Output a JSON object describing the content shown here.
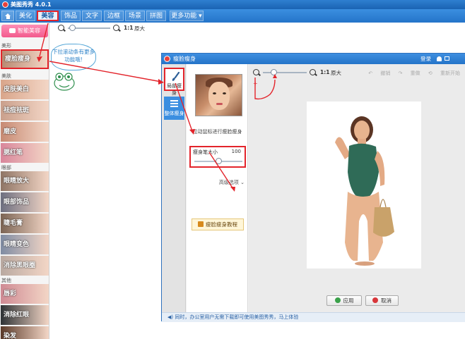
{
  "app": {
    "title": "美图秀秀 4.0.1"
  },
  "menu": {
    "home_icon": "home-icon",
    "tabs": [
      {
        "label": "美化"
      },
      {
        "label": "美容"
      },
      {
        "label": "饰品"
      },
      {
        "label": "文字"
      },
      {
        "label": "边框"
      },
      {
        "label": "场景"
      },
      {
        "label": "拼图"
      },
      {
        "label": "更多功能 ▾"
      }
    ],
    "active_index": 1
  },
  "main_zoom": {
    "ratio": "1:1",
    "size_label": "原大"
  },
  "sidebar": {
    "one_click": "智能美容",
    "sections": [
      {
        "label": "美形"
      },
      {
        "label": "美肤"
      },
      {
        "label": "眼部"
      },
      {
        "label": "其他"
      }
    ],
    "items": [
      {
        "label": "瘦脸瘦身",
        "color": "#b98a72"
      },
      {
        "label": "皮肤美白",
        "color": "#d9a58a"
      },
      {
        "label": "祛痘祛斑",
        "color": "#caa08c"
      },
      {
        "label": "磨皮",
        "color": "#c78a73"
      },
      {
        "label": "腮红笔",
        "color": "#d9869b"
      },
      {
        "label": "眼睛放大",
        "color": "#8f7565"
      },
      {
        "label": "眼部饰品",
        "color": "#6d6f80"
      },
      {
        "label": "睫毛膏",
        "color": "#7b6454"
      },
      {
        "label": "眼睛变色",
        "color": "#7f8ca3"
      },
      {
        "label": "消除黑眼圈",
        "color": "#b9a9a1"
      },
      {
        "label": "唇彩",
        "color": "#cf8a94"
      },
      {
        "label": "消除红眼",
        "color": "#2f3336"
      },
      {
        "label": "染发",
        "color": "#5c3b2a"
      }
    ]
  },
  "callout": {
    "text": "下拉滚动条有更多功能哦!"
  },
  "dialog": {
    "title": "瘦脸瘦身",
    "login": "登录",
    "tools": [
      {
        "label": "局部瘦身",
        "icon": "brush-icon"
      },
      {
        "label": "整体瘦身",
        "icon": "menu-lines-icon"
      }
    ],
    "hint": "拉动鼠标进行瘦脸瘦身",
    "brush": {
      "label": "瘦身笔大小",
      "value": "100",
      "level": 0.5
    },
    "advanced": "高级选项",
    "tutorial": "瘦脸瘦身教程",
    "zoom": {
      "ratio": "1:1",
      "size_label": "原大"
    },
    "toolbar": {
      "undo": "撤销",
      "redo": "重做",
      "reset": "重新开始"
    },
    "apply": "应用",
    "cancel": "取消",
    "footer": "同时，办公室用户无需下载即可使用美图秀秀，马上体验"
  },
  "colors": {
    "accent": "#2474c9",
    "annotation": "#e3242b"
  }
}
